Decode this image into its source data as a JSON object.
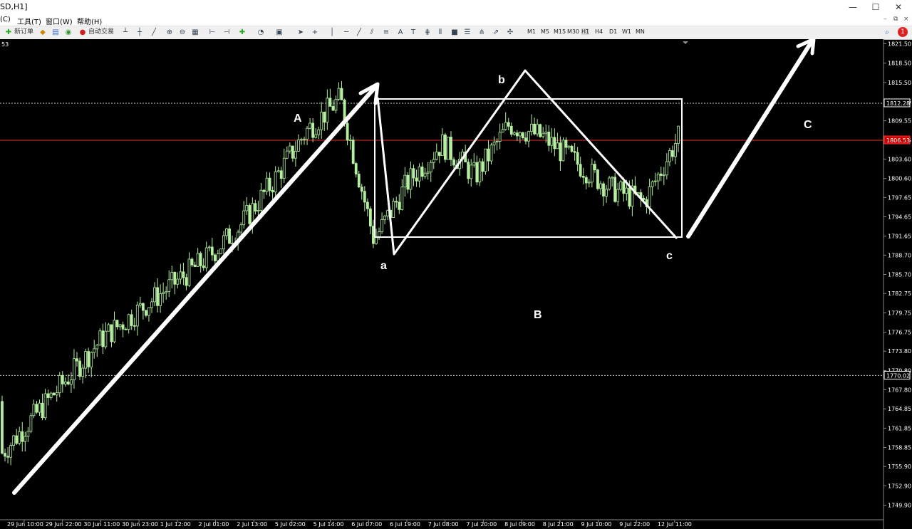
{
  "window": {
    "title": "SD,H1]",
    "buttons": [
      "—",
      "☐",
      "✕"
    ]
  },
  "menu": {
    "items": [
      "(C)",
      "工具(T)",
      "窗口(W)",
      "帮助(H)"
    ],
    "mdi_buttons": [
      "–",
      "⧉",
      "×"
    ]
  },
  "toolbar": {
    "new_order": "新订单",
    "auto_trade": "自动交易",
    "timeframes": [
      "M1",
      "M5",
      "M15",
      "M30",
      "H1",
      "H4",
      "D1",
      "W1",
      "MN"
    ],
    "active_timeframe": "H1",
    "alert_badge": "1"
  },
  "chart_data": {
    "type": "candlestick",
    "symbol_fragment": "53",
    "y_ticks": [
      1821.5,
      1818.5,
      1815.5,
      1812.55,
      1809.55,
      1806.55,
      1803.6,
      1800.6,
      1797.65,
      1794.65,
      1791.65,
      1788.7,
      1785.7,
      1782.75,
      1779.75,
      1776.75,
      1773.8,
      1770.8,
      1767.8,
      1764.85,
      1761.85,
      1758.85,
      1755.9,
      1752.9,
      1749.9
    ],
    "ylim": [
      1748.3,
      1822.0
    ],
    "highlighted_prices": [
      {
        "label": "1812.28",
        "value": 1812.28,
        "color": "#ffffff",
        "style": "dotted"
      },
      {
        "label": "1806.53",
        "value": 1806.53,
        "color": "#ff3333",
        "style": "solid"
      },
      {
        "label": "1770.02",
        "value": 1770.02,
        "color": "#ffffff",
        "style": "dotted"
      }
    ],
    "x_ticks": [
      "29 Jun 10:00",
      "29 Jun 22:00",
      "30 Jun 11:00",
      "30 Jun 23:00",
      "1 Jul 12:00",
      "2 Jul 01:00",
      "2 Jul 13:00",
      "5 Jul 02:00",
      "5 Jul 14:00",
      "6 Jul 07:00",
      "6 Jul 19:00",
      "7 Jul 08:00",
      "7 Jul 20:00",
      "8 Jul 09:00",
      "8 Jul 21:00",
      "9 Jul 10:00",
      "9 Jul 22:00",
      "12 Jul 11:00"
    ],
    "candle_color": "#b4f0a0",
    "path_anchor_prices": [
      1758,
      1764,
      1770,
      1776,
      1780,
      1784,
      1788,
      1793,
      1800,
      1808,
      1813,
      1791,
      1800,
      1806,
      1801,
      1809,
      1807,
      1803,
      1799,
      1797,
      1807
    ]
  },
  "annotations": {
    "labels": [
      "A",
      "a",
      "b",
      "B",
      "c",
      "C"
    ],
    "color": "#ffffff"
  }
}
